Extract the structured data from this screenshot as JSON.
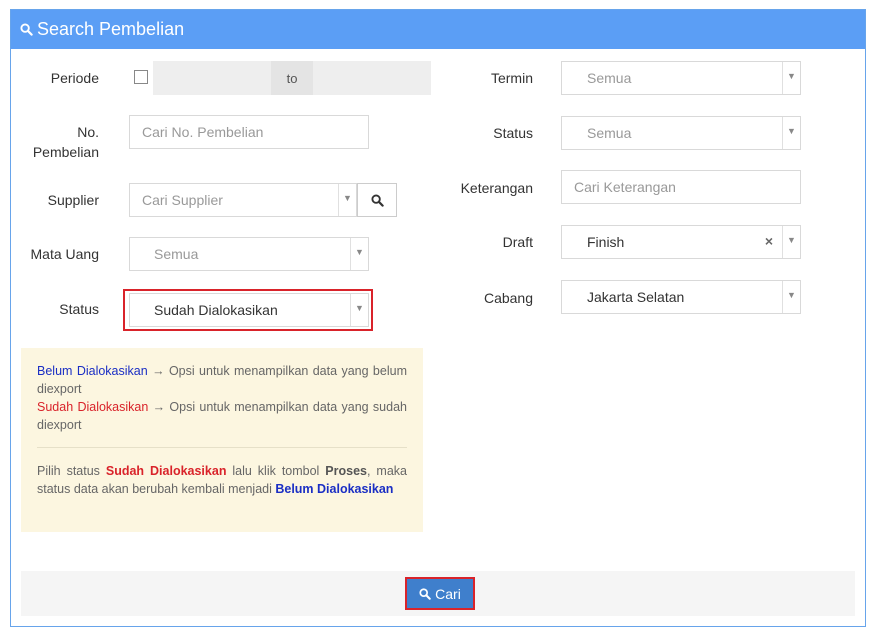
{
  "header": {
    "title": "Search Pembelian",
    "icon": "search-icon"
  },
  "left": {
    "periode_label": "Periode",
    "periode_to": "to",
    "no_pembelian_label_1": "No.",
    "no_pembelian_label_2": "Pembelian",
    "no_pembelian_placeholder": "Cari No. Pembelian",
    "supplier_label": "Supplier",
    "supplier_placeholder": "Cari Supplier",
    "mata_uang_label": "Mata Uang",
    "mata_uang_value": "Semua",
    "status_label": "Status",
    "status_value": "Sudah Dialokasikan"
  },
  "right": {
    "termin_label": "Termin",
    "termin_value": "Semua",
    "status_label": "Status",
    "status_value": "Semua",
    "keterangan_label": "Keterangan",
    "keterangan_placeholder": "Cari Keterangan",
    "draft_label": "Draft",
    "draft_value": "Finish",
    "draft_clear": "×",
    "cabang_label": "Cabang",
    "cabang_value": "Jakarta Selatan"
  },
  "note": {
    "line1_term": "Belum Dialokasikan",
    "line1_text": "→ Opsi untuk menampilkan data yang belum diexport",
    "line2_term": "Sudah Dialokasikan",
    "line2_text": "→ Opsi untuk menampilkan data yang sudah diexport",
    "p_start": "Pilih status ",
    "p_term1": "Sudah Dialokasikan",
    "p_mid": " lalu klik tombol ",
    "p_term2": "Proses",
    "p_mid2": ", maka status data akan berubah kembali menjadi ",
    "p_term3": "Belum Dialokasikan"
  },
  "footer": {
    "cari_label": "Cari"
  },
  "colors": {
    "header": "#5b9ef5",
    "highlight": "#d9232a",
    "button": "#3f7fcc",
    "note_bg": "#fcf6e0"
  }
}
